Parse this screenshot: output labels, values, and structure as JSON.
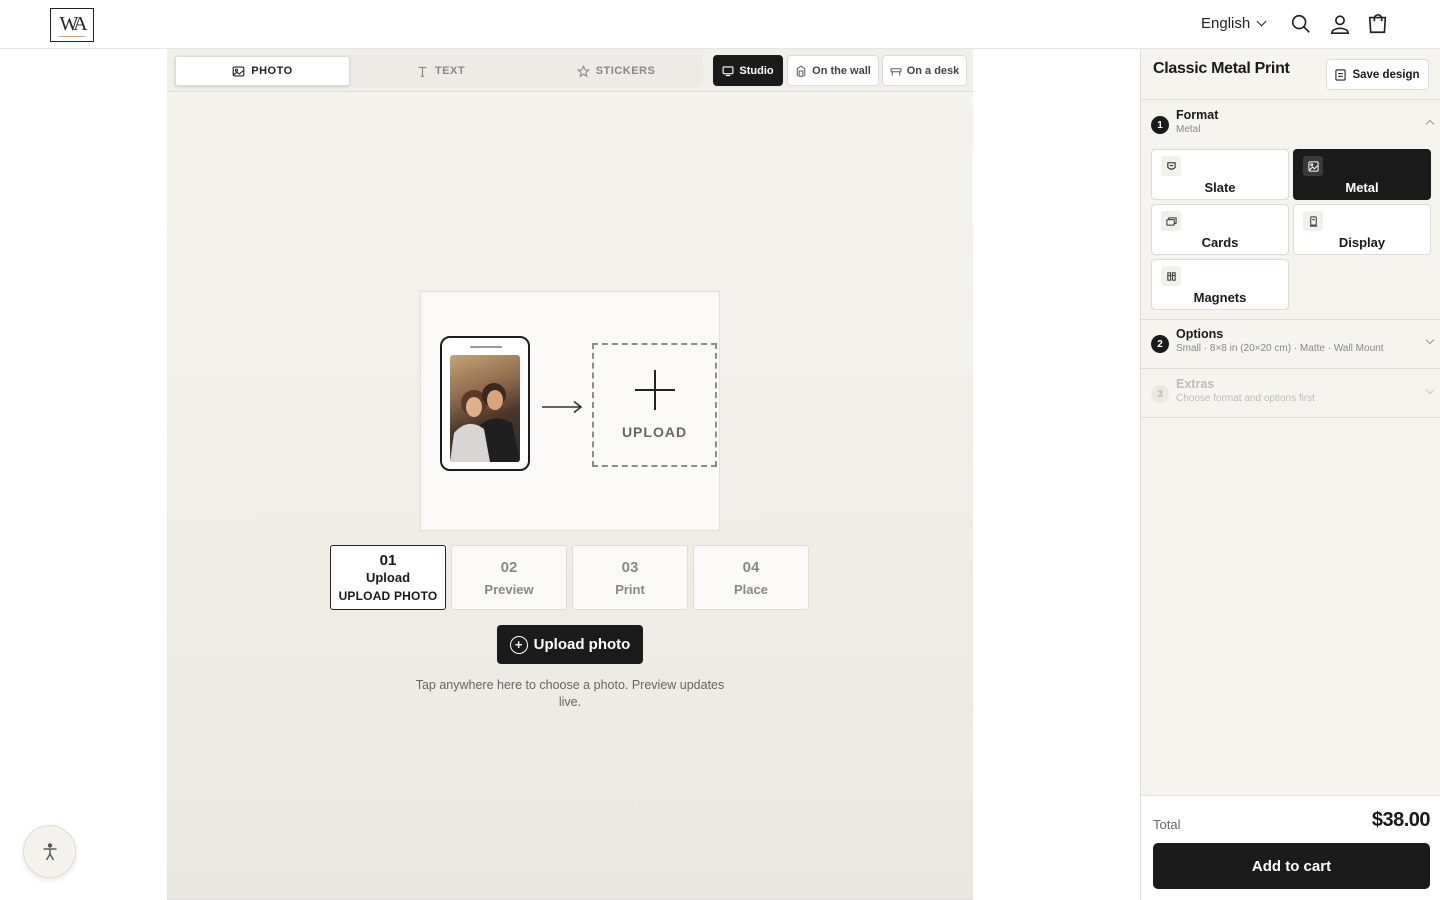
{
  "header": {
    "logo_text": "WA",
    "language": "English"
  },
  "canvas": {
    "tabs": [
      {
        "label": "PHOTO",
        "icon": "image-icon",
        "active": true
      },
      {
        "label": "TEXT",
        "icon": "text-icon",
        "active": false
      },
      {
        "label": "STICKERS",
        "icon": "star-icon",
        "active": false
      }
    ],
    "views": [
      {
        "label": "Studio",
        "icon": "monitor-icon",
        "active": true
      },
      {
        "label": "On the wall",
        "icon": "wall-icon",
        "active": false
      },
      {
        "label": "On a desk",
        "icon": "desk-icon",
        "active": false
      }
    ],
    "dropzone_label": "UPLOAD",
    "steps": [
      {
        "num": "01",
        "name": "Upload",
        "sub": "UPLOAD PHOTO",
        "active": true
      },
      {
        "num": "02",
        "name": "Preview",
        "sub": "",
        "active": false
      },
      {
        "num": "03",
        "name": "Print",
        "sub": "",
        "active": false
      },
      {
        "num": "04",
        "name": "Place",
        "sub": "",
        "active": false
      }
    ],
    "upload_button": "Upload photo",
    "hint": "Tap anywhere here to choose a photo. Preview updates live."
  },
  "panel": {
    "title": "Classic Metal Print",
    "save_label": "Save design",
    "sections": [
      {
        "num": "1",
        "title": "Format",
        "subtitle": "Metal"
      },
      {
        "num": "2",
        "title": "Options",
        "subtitle": "Small · 8×8 in (20×20 cm) · Matte · Wall Mount"
      },
      {
        "num": "3",
        "title": "Extras",
        "subtitle": "Choose format and options first"
      }
    ],
    "formats": [
      {
        "label": "Slate",
        "icon": "slate-icon",
        "active": false
      },
      {
        "label": "Metal",
        "icon": "metal-icon",
        "active": true
      },
      {
        "label": "Cards",
        "icon": "cards-icon",
        "active": false
      },
      {
        "label": "Display",
        "icon": "display-icon",
        "active": false
      },
      {
        "label": "Magnets",
        "icon": "magnet-icon",
        "active": false
      }
    ],
    "total_label": "Total",
    "total_value": "$38.00",
    "cart_label": "Add to cart"
  },
  "colors": {
    "accent": "#1b1b1b",
    "canvas_bg": "#f1efea",
    "panel_bg": "#f6f4ef"
  }
}
